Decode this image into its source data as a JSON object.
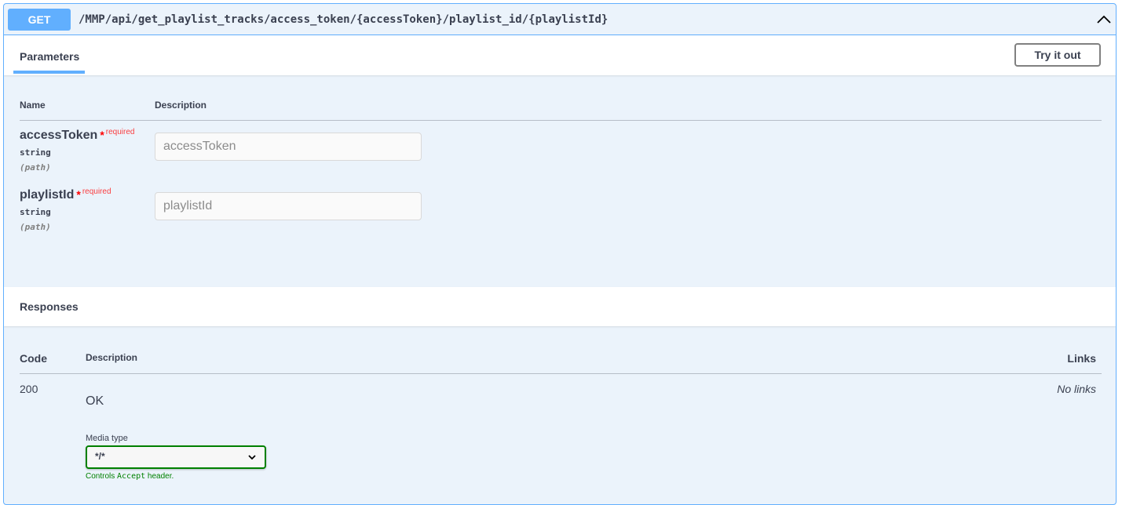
{
  "operation": {
    "method": "GET",
    "path": "/MMP/api/get_playlist_tracks/access_token/{accessToken}/playlist_id/{playlistId}"
  },
  "parameters": {
    "tab_label": "Parameters",
    "try_button": "Try it out",
    "columns": {
      "name": "Name",
      "description": "Description"
    },
    "items": [
      {
        "name": "accessToken",
        "required_star": "*",
        "required_text": "required",
        "type": "string",
        "in": "(path)",
        "placeholder": "accessToken"
      },
      {
        "name": "playlistId",
        "required_star": "*",
        "required_text": "required",
        "type": "string",
        "in": "(path)",
        "placeholder": "playlistId"
      }
    ]
  },
  "responses": {
    "title": "Responses",
    "columns": {
      "code": "Code",
      "description": "Description",
      "links": "Links"
    },
    "items": [
      {
        "code": "200",
        "description": "OK",
        "links": "No links",
        "media_type_label": "Media type",
        "media_type_value": "*/*",
        "media_note_prefix": "Controls ",
        "media_note_code": "Accept",
        "media_note_suffix": " header."
      }
    ]
  },
  "colors": {
    "get_accent": "#61affe",
    "block_bg": "#ebf3fb",
    "required": "#ff0000",
    "media_ok": "#008000"
  }
}
